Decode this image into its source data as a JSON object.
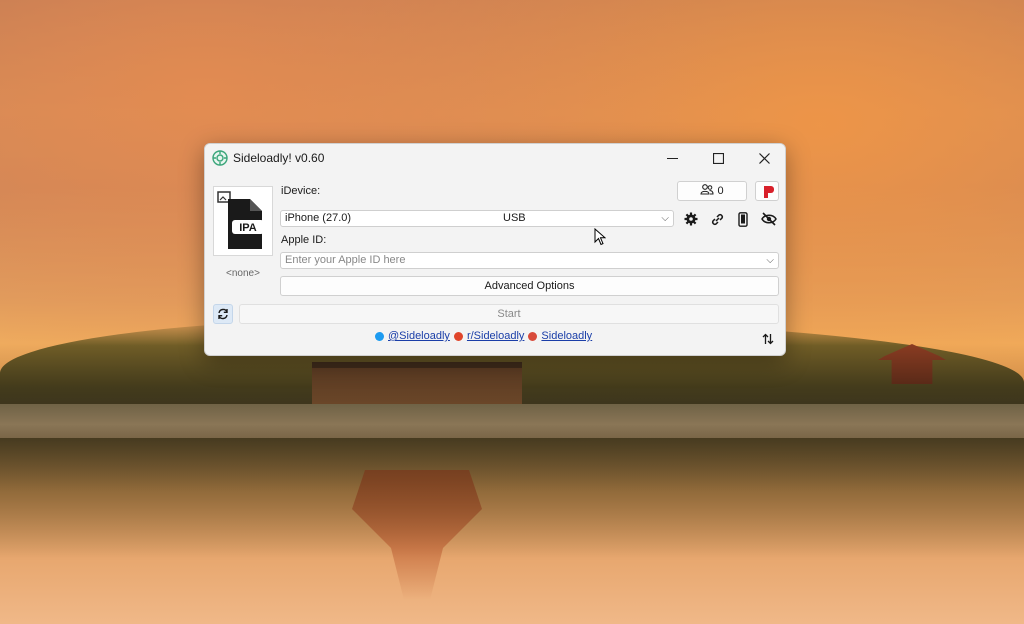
{
  "window": {
    "title": "Sideloadly! v0.60",
    "controls": {
      "minimize": "—",
      "maximize": "☐",
      "close": "✕"
    }
  },
  "ipa": {
    "icon_text": "IPA",
    "selected_file": "<none>"
  },
  "idevice": {
    "label": "iDevice:",
    "device_name": "iPhone (27.0)",
    "connection": "USB",
    "counter_value": "0"
  },
  "apple_id": {
    "label": "Apple ID:",
    "placeholder": "Enter your Apple ID here"
  },
  "actions": {
    "advanced_options": "Advanced Options",
    "start": "Start"
  },
  "links": {
    "twitter": "@Sideloadly",
    "reddit": "r/Sideloadly",
    "patreon": "Sideloadly"
  },
  "colors": {
    "record": "#d8202a",
    "link": "#1a3ea8",
    "refresh_bg": "#dde9f6"
  },
  "icons": [
    "app-logo-icon",
    "ipa-file-icon",
    "users-icon",
    "record-icon",
    "gear-icon",
    "link-icon",
    "phone-icon",
    "eye-off-icon",
    "refresh-icon",
    "twitter-icon",
    "reddit-icon",
    "patreon-icon",
    "sort-icon"
  ]
}
